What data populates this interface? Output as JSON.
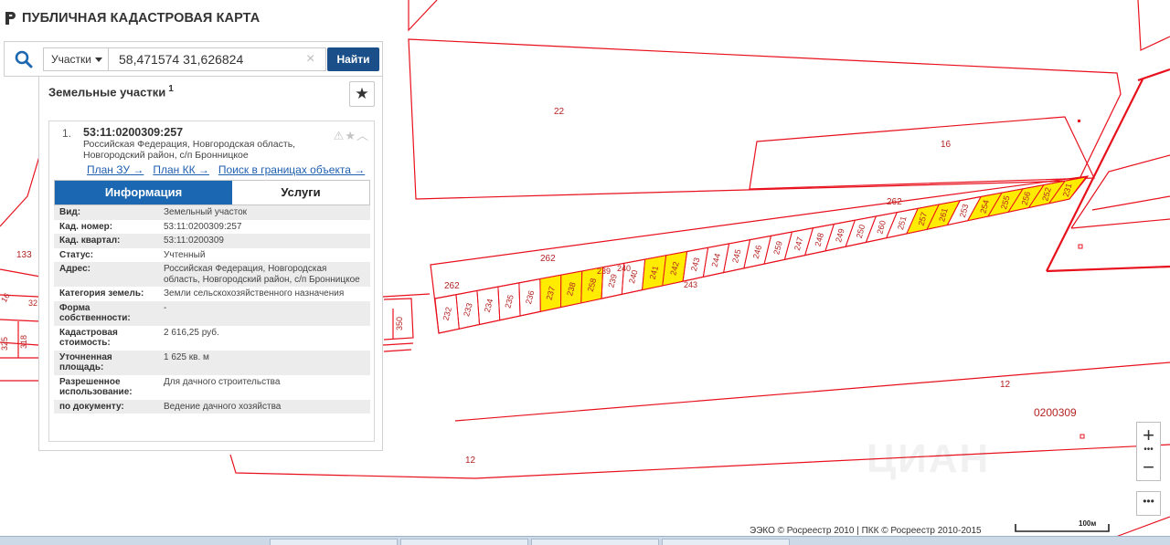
{
  "app": {
    "title": "ПУБЛИЧНАЯ КАДАСТРОВАЯ КАРТА"
  },
  "search": {
    "type_label": "Участки",
    "query": "58,471574 31,626824",
    "clear_icon": "×",
    "button_label": "Найти"
  },
  "panel": {
    "title": "Земельные участки",
    "count": "1",
    "result": {
      "index": "1.",
      "cad_number": "53:11:0200309:257",
      "address_line1": "Российская Федерация, Новгородская область,",
      "address_line2": "Новгородский район, с/п Бронницкое",
      "links": [
        "План ЗУ →",
        "План КК →",
        "Поиск в границах объекта →"
      ]
    },
    "tabs": [
      "Информация",
      "Услуги"
    ],
    "info": [
      {
        "key": "Вид:",
        "value": "Земельный участок"
      },
      {
        "key": "Кад. номер:",
        "value": "53:11:0200309:257"
      },
      {
        "key": "Кад. квартал:",
        "value": "53:11:0200309"
      },
      {
        "key": "Статус:",
        "value": "Учтенный"
      },
      {
        "key": "Адрес:",
        "value": "Российская Федерация, Новгородская область, Новгородский район, с/п Бронницкое"
      },
      {
        "key": "Категория земель:",
        "value": "Земли сельскохозяйственного назначения"
      },
      {
        "key": "Форма собственности:",
        "value": "-"
      },
      {
        "key": "Кадастровая стоимость:",
        "value": "2 616,25 руб."
      },
      {
        "key": "Уточненная площадь:",
        "value": "1 625 кв. м"
      },
      {
        "key": "Разрешенное использование:",
        "value": "Для дачного строительства"
      },
      {
        "key": "по документу:",
        "value": "Ведение дачного хозяйства"
      }
    ]
  },
  "map": {
    "colors": {
      "boundary": "#e8101c",
      "label": "#b52323",
      "selected_fill": "#ffec00",
      "accent": "#1b67b1"
    },
    "labels": {
      "l22": "22",
      "l16": "16",
      "l262a": "262",
      "l262b": "262",
      "l262c": "262",
      "l133": "133",
      "l12a": "12",
      "l12b": "12",
      "quarter": "0200309",
      "l350": "350",
      "l325": "325",
      "l318": "318",
      "l32": "32",
      "l16b": "16"
    },
    "plots": [
      "232",
      "233",
      "234",
      "235",
      "236",
      "237",
      "238",
      "258",
      "239",
      "240",
      "241",
      "242",
      "243",
      "244",
      "245",
      "246",
      "259",
      "247",
      "248",
      "249",
      "250",
      "260",
      "251",
      "257",
      "261",
      "253",
      "254",
      "255",
      "256",
      "252",
      "231"
    ],
    "selected_plots": [
      "237",
      "238",
      "258",
      "241",
      "242",
      "257",
      "261",
      "254",
      "255",
      "256",
      "252",
      "231"
    ],
    "extra_labels": {
      "top239": "239",
      "top240": "240",
      "r243": "243"
    },
    "zoom": {
      "in": "+",
      "out": "−",
      "dots": "•••",
      "more": "•••"
    },
    "attribution": "ЭЭКО © Росреестр 2010 | ПКК © Росреестр 2010-2015",
    "scale_label": "100м",
    "watermark": "ЦИАН"
  }
}
